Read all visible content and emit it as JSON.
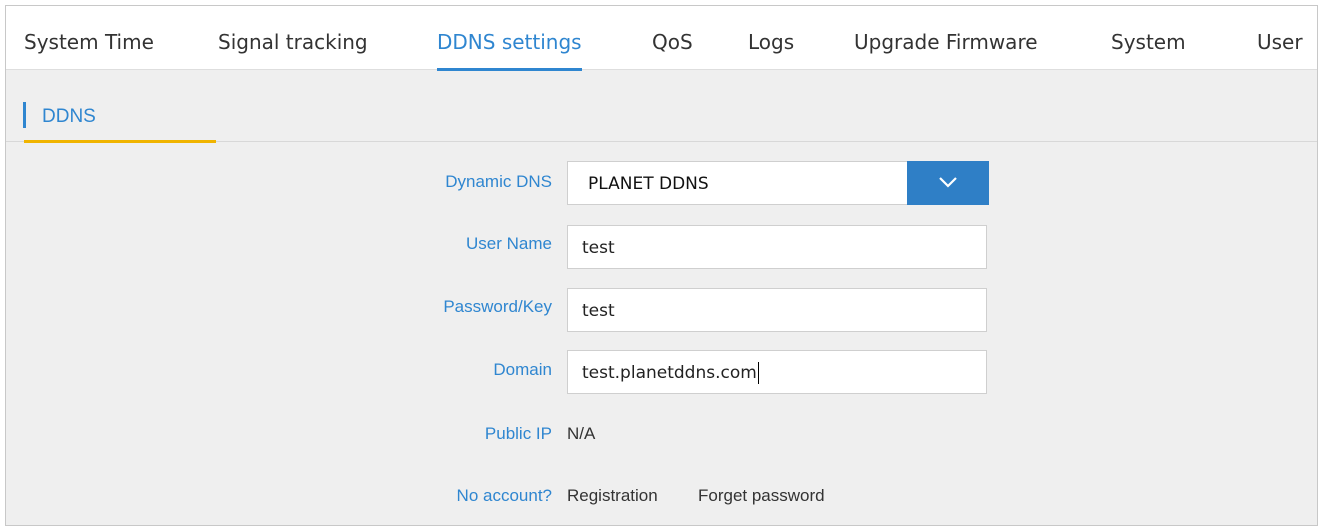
{
  "nav": {
    "tabs": [
      {
        "label": "System Time",
        "active": false
      },
      {
        "label": "Signal tracking",
        "active": false
      },
      {
        "label": "DDNS settings",
        "active": true
      },
      {
        "label": "QoS",
        "active": false
      },
      {
        "label": "Logs",
        "active": false
      },
      {
        "label": "Upgrade Firmware",
        "active": false
      },
      {
        "label": "System",
        "active": false
      },
      {
        "label": "User",
        "active": false
      }
    ]
  },
  "section": {
    "title": "DDNS"
  },
  "form": {
    "dynamic_dns": {
      "label": "Dynamic DNS",
      "value": "PLANET DDNS"
    },
    "user_name": {
      "label": "User Name",
      "value": "test"
    },
    "password": {
      "label": "Password/Key",
      "value": "test"
    },
    "domain": {
      "label": "Domain",
      "value": "test.planetddns.com"
    },
    "public_ip": {
      "label": "Public IP",
      "value": "N/A"
    },
    "account": {
      "label": "No account?",
      "registration": "Registration",
      "forget_password": "Forget password"
    }
  },
  "colors": {
    "accent": "#2f86d0",
    "section_underline": "#f0b400",
    "background": "#efefef"
  },
  "icons": {
    "dropdown": "chevron-down-icon"
  }
}
